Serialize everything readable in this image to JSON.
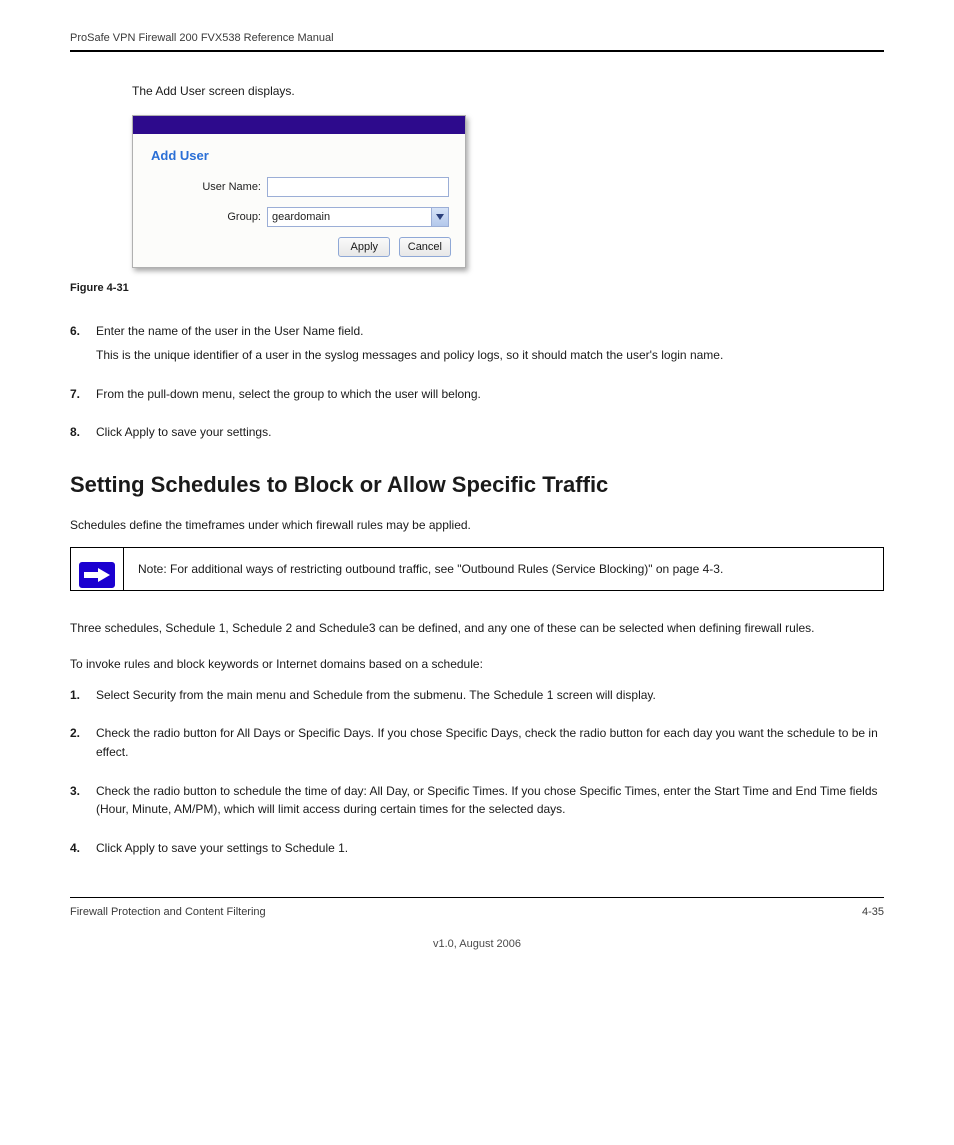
{
  "header": {
    "left": "ProSafe VPN Firewall 200 FVX538 Reference Manual",
    "right": ""
  },
  "intro": "The Add User screen displays.",
  "dialog": {
    "title": "Add User",
    "fields": {
      "username_label": "User Name:",
      "username_value": "",
      "username_placeholder": "",
      "group_label": "Group:",
      "group_value": "geardomain"
    },
    "buttons": {
      "apply": "Apply",
      "cancel": "Cancel"
    }
  },
  "figure_caption": "Figure 4-31",
  "steps": [
    {
      "num": "6.",
      "lines": [
        "Enter the name of the user in the User Name field.",
        "This is the unique identifier of a user in the syslog messages and policy logs, so it should match the user's login name."
      ]
    },
    {
      "num": "7.",
      "lines": [
        "From the pull-down menu, select the group to which the user will belong."
      ]
    },
    {
      "num": "8.",
      "lines": [
        "Click Apply to save your settings."
      ]
    }
  ],
  "section_heading": "Setting Schedules to Block or Allow Specific Traffic",
  "section_intro": "Schedules define the timeframes under which firewall rules may be applied.",
  "note": "Note: For additional ways of restricting outbound traffic, see \"Outbound Rules (Service Blocking)\" on page 4-3.",
  "body_paragraph": "Three schedules, Schedule 1, Schedule 2 and Schedule3 can be defined, and any one of these can be selected when defining firewall rules.",
  "procedure_intro": "To invoke rules and block keywords or Internet domains based on a schedule:",
  "proc_steps": [
    {
      "num": "1.",
      "lines": [
        "Select Security from the main menu and Schedule from the submenu. The Schedule 1 screen will display."
      ]
    },
    {
      "num": "2.",
      "lines": [
        "Check the radio button for All Days or Specific Days. If you chose Specific Days, check the radio button for each day you want the schedule to be in effect."
      ]
    },
    {
      "num": "3.",
      "lines": [
        "Check the radio button to schedule the time of day: All Day, or Specific Times. If you chose Specific Times, enter the Start Time and End Time fields (Hour, Minute, AM/PM), which will limit access during certain times for the selected days."
      ]
    },
    {
      "num": "4.",
      "lines": [
        "Click Apply to save your settings to Schedule 1."
      ]
    }
  ],
  "footer": {
    "left": "Firewall Protection and Content Filtering",
    "right": "4-35",
    "version": "v1.0, August 2006"
  }
}
